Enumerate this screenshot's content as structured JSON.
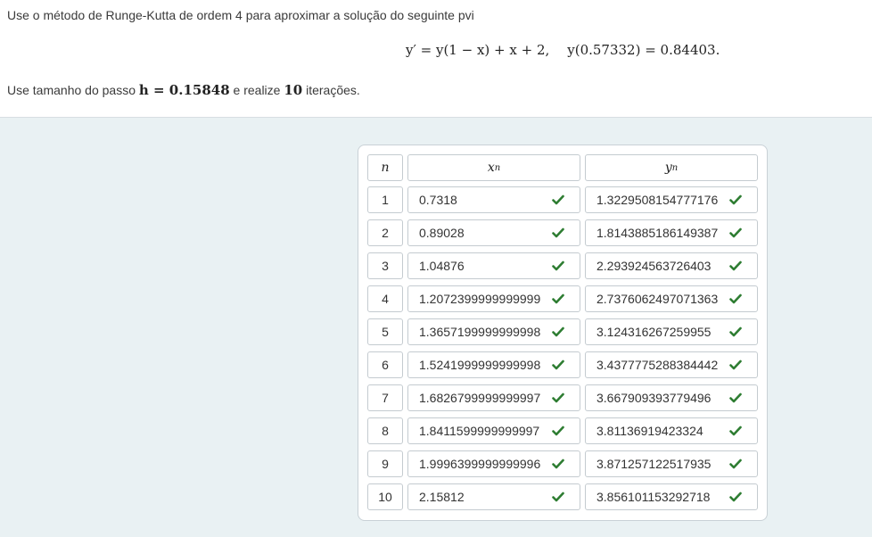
{
  "question": {
    "line1": "Use o método de Runge-Kutta de ordem 4 para aproximar a solução do seguinte pvi",
    "equation": "y′ = y(1 − x) + x + 2,",
    "initial_condition": "y(0.57332) = 0.84403.",
    "line3_prefix": "Use tamanho do passo",
    "step": "h = 0.15848",
    "line3_mid": "e realize",
    "iterations": "10",
    "line3_suffix": "iterações."
  },
  "table": {
    "headers": {
      "n": "n",
      "x": "x",
      "x_sub": "n",
      "y": "y",
      "y_sub": "n"
    },
    "rows": [
      {
        "n": "1",
        "x": "0.7318",
        "y": "1.3229508154777176"
      },
      {
        "n": "2",
        "x": "0.89028",
        "y": "1.8143885186149387"
      },
      {
        "n": "3",
        "x": "1.04876",
        "y": "2.293924563726403"
      },
      {
        "n": "4",
        "x": "1.2072399999999999",
        "y": "2.7376062497071363"
      },
      {
        "n": "5",
        "x": "1.3657199999999998",
        "y": "3.124316267259955"
      },
      {
        "n": "6",
        "x": "1.5241999999999998",
        "y": "3.4377775288384442"
      },
      {
        "n": "7",
        "x": "1.6826799999999997",
        "y": "3.667909393779496"
      },
      {
        "n": "8",
        "x": "1.8411599999999997",
        "y": "3.81136919423324"
      },
      {
        "n": "9",
        "x": "1.9996399999999996",
        "y": "3.871257122517935"
      },
      {
        "n": "10",
        "x": "2.15812",
        "y": "3.856101153292718"
      }
    ],
    "status_icon": "check-icon",
    "check_color": "#2e7d32"
  }
}
